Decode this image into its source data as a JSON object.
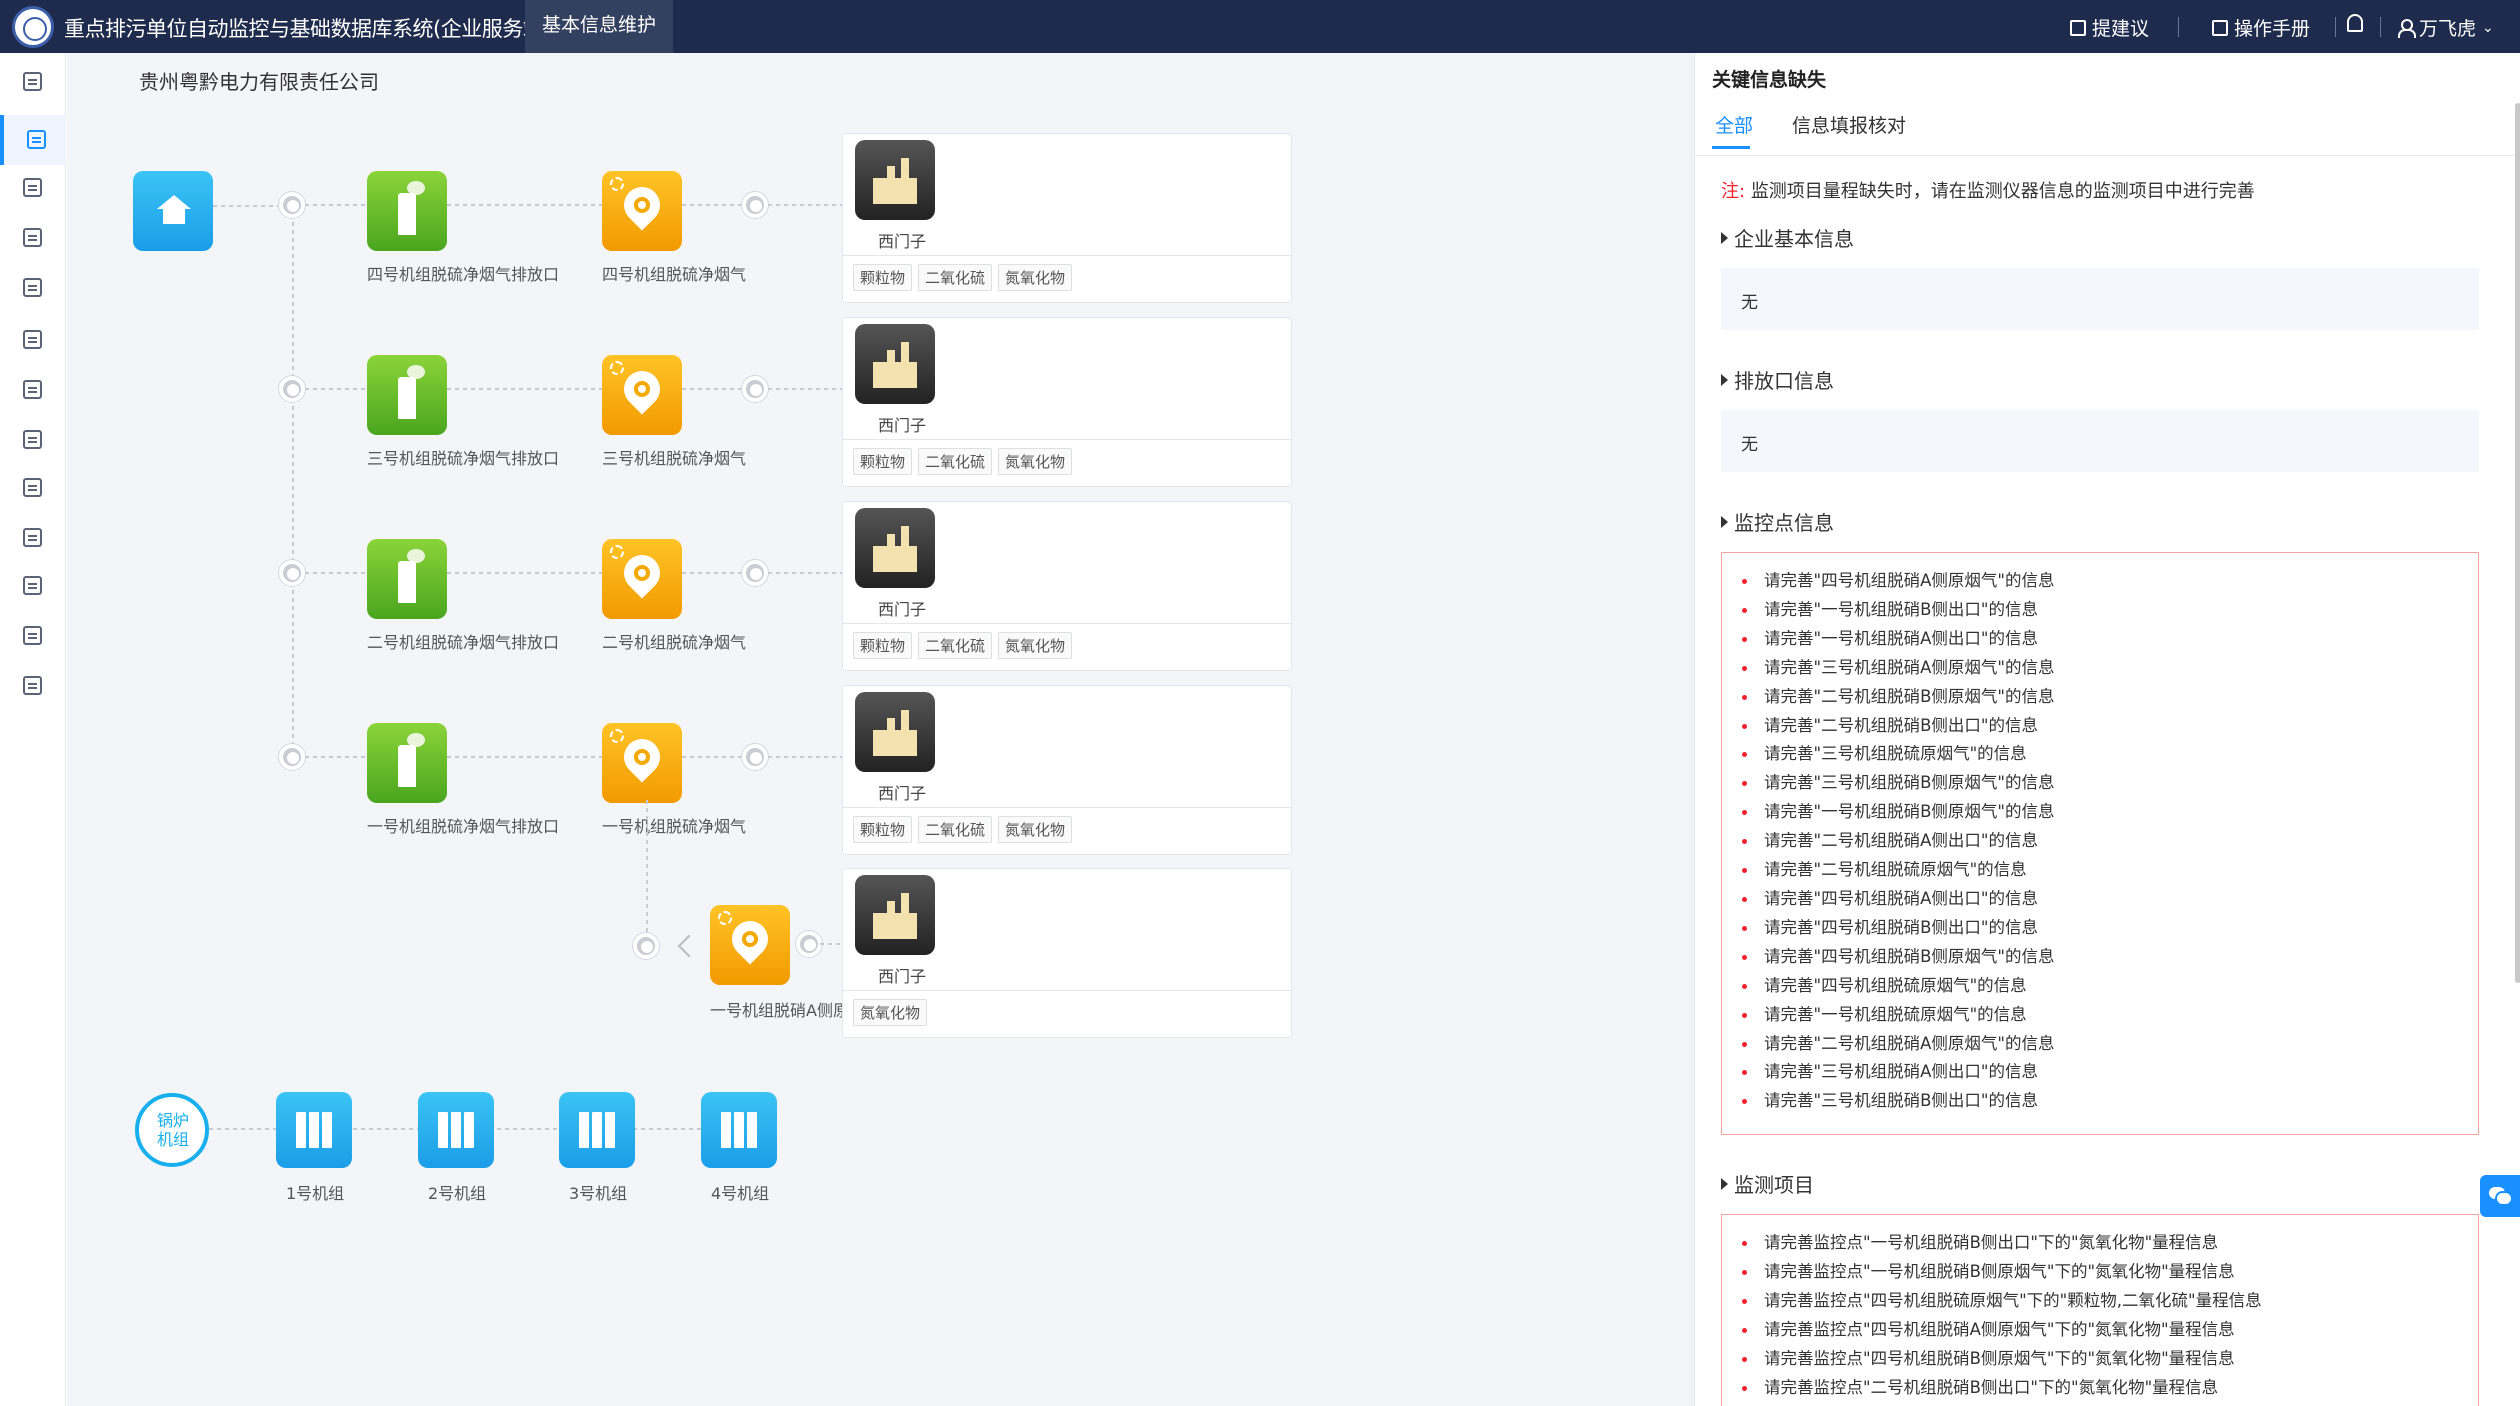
{
  "header": {
    "app_title": "重点排污单位自动监控与基础数据库系统(企业服务端)",
    "active_tab": "基本信息维护",
    "suggest": "提建议",
    "manual": "操作手册",
    "user": "万飞虎"
  },
  "main": {
    "company": "贵州粤黔电力有限责任公司",
    "rows": [
      {
        "outlet": "四号机组脱硫净烟气排放口",
        "monitor": "四号机组脱硫净烟气",
        "site": "西门子",
        "pollutants": [
          "颗粒物",
          "二氧化硫",
          "氮氧化物"
        ]
      },
      {
        "outlet": "三号机组脱硫净烟气排放口",
        "monitor": "三号机组脱硫净烟气",
        "site": "西门子",
        "pollutants": [
          "颗粒物",
          "二氧化硫",
          "氮氧化物"
        ]
      },
      {
        "outlet": "二号机组脱硫净烟气排放口",
        "monitor": "二号机组脱硫净烟气",
        "site": "西门子",
        "pollutants": [
          "颗粒物",
          "二氧化硫",
          "氮氧化物"
        ]
      },
      {
        "outlet": "一号机组脱硫净烟气排放口",
        "monitor": "一号机组脱硫净烟气",
        "site": "西门子",
        "pollutants": [
          "颗粒物",
          "二氧化硫",
          "氮氧化物"
        ]
      }
    ],
    "branch": {
      "monitor": "一号机组脱硝A侧原",
      "site": "西门子",
      "pollutants": [
        "氮氧化物"
      ]
    },
    "boiler_label": "锅炉机组",
    "units": [
      "1号机组",
      "2号机组",
      "3号机组",
      "4号机组"
    ]
  },
  "panel": {
    "title": "关键信息缺失",
    "tabs": [
      "全部",
      "信息填报核对"
    ],
    "note_prefix": "注:",
    "note_text": "监测项目量程缺失时，请在监测仪器信息的监测项目中进行完善",
    "sections": {
      "basic": "企业基本信息",
      "outlet": "排放口信息",
      "monitor_point": "监控点信息",
      "items": "监测项目"
    },
    "none": "无",
    "monitor_point_msgs": [
      "请完善\"四号机组脱硝A侧原烟气\"的信息",
      "请完善\"一号机组脱硝B侧出口\"的信息",
      "请完善\"一号机组脱硝A侧出口\"的信息",
      "请完善\"三号机组脱硝A侧原烟气\"的信息",
      "请完善\"二号机组脱硝B侧原烟气\"的信息",
      "请完善\"二号机组脱硝B侧出口\"的信息",
      "请完善\"三号机组脱硫原烟气\"的信息",
      "请完善\"三号机组脱硝B侧原烟气\"的信息",
      "请完善\"一号机组脱硝B侧原烟气\"的信息",
      "请完善\"二号机组脱硝A侧出口\"的信息",
      "请完善\"二号机组脱硫原烟气\"的信息",
      "请完善\"四号机组脱硝A侧出口\"的信息",
      "请完善\"四号机组脱硝B侧出口\"的信息",
      "请完善\"四号机组脱硝B侧原烟气\"的信息",
      "请完善\"四号机组脱硫原烟气\"的信息",
      "请完善\"一号机组脱硫原烟气\"的信息",
      "请完善\"二号机组脱硝A侧原烟气\"的信息",
      "请完善\"三号机组脱硝A侧出口\"的信息",
      "请完善\"三号机组脱硝B侧出口\"的信息"
    ],
    "item_msgs": [
      "请完善监控点\"一号机组脱硝B侧出口\"下的\"氮氧化物\"量程信息",
      "请完善监控点\"一号机组脱硝B侧原烟气\"下的\"氮氧化物\"量程信息",
      "请完善监控点\"四号机组脱硫原烟气\"下的\"颗粒物,二氧化硫\"量程信息",
      "请完善监控点\"四号机组脱硝A侧原烟气\"下的\"氮氧化物\"量程信息",
      "请完善监控点\"四号机组脱硝B侧原烟气\"下的\"氮氧化物\"量程信息",
      "请完善监控点\"二号机组脱硝B侧出口\"下的\"氮氧化物\"量程信息"
    ]
  }
}
